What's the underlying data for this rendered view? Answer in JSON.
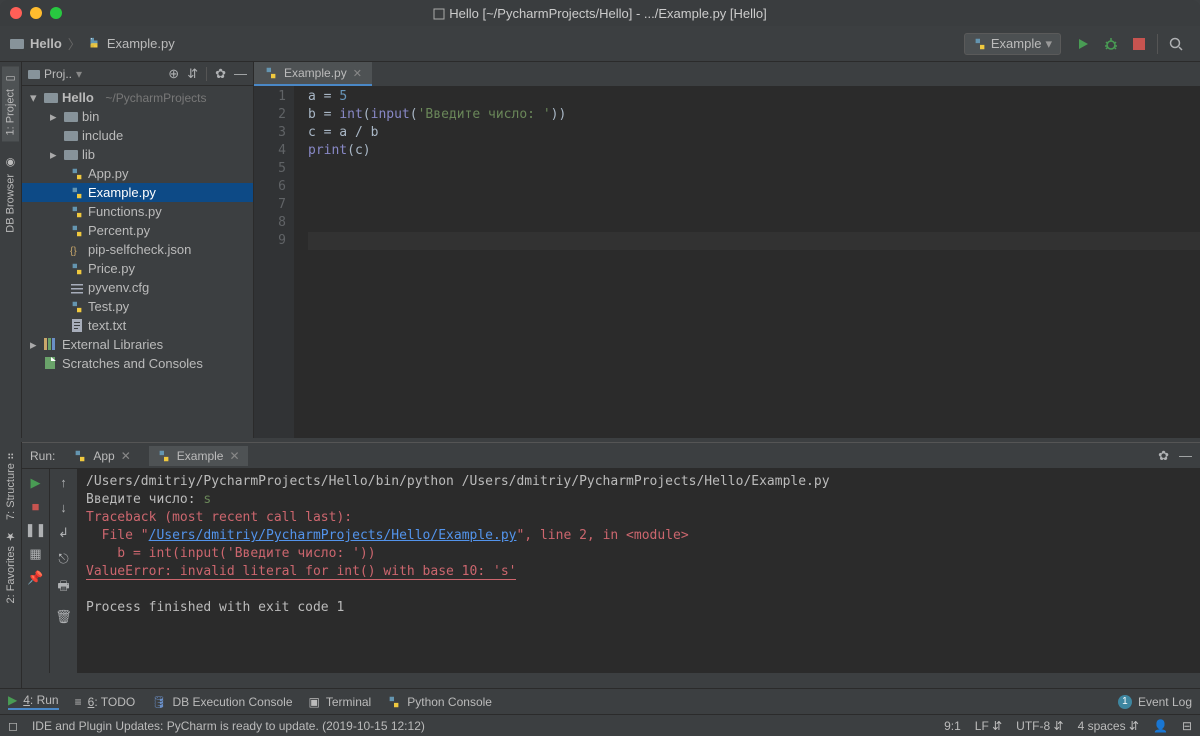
{
  "title": "Hello [~/PycharmProjects/Hello] - .../Example.py [Hello]",
  "breadcrumb": {
    "project": "Hello",
    "file": "Example.py"
  },
  "run_config": "Example",
  "project_pane": {
    "label": "Proj..",
    "root": {
      "name": "Hello",
      "path": "~/PycharmProjects"
    },
    "children": [
      {
        "name": "bin",
        "folder": true,
        "expand": true,
        "lvl": 1
      },
      {
        "name": "include",
        "folder": true,
        "expand": false,
        "lvl": 1
      },
      {
        "name": "lib",
        "folder": true,
        "expand": true,
        "lvl": 1
      },
      {
        "name": "App.py",
        "py": true,
        "lvl": 2
      },
      {
        "name": "Example.py",
        "py": true,
        "lvl": 2,
        "selected": true
      },
      {
        "name": "Functions.py",
        "py": true,
        "lvl": 2
      },
      {
        "name": "Percent.py",
        "py": true,
        "lvl": 2
      },
      {
        "name": "pip-selfcheck.json",
        "json": true,
        "lvl": 2
      },
      {
        "name": "Price.py",
        "py": true,
        "lvl": 2
      },
      {
        "name": "pyvenv.cfg",
        "cfg": true,
        "lvl": 2
      },
      {
        "name": "Test.py",
        "py": true,
        "lvl": 2
      },
      {
        "name": "text.txt",
        "txt": true,
        "lvl": 2
      }
    ],
    "ext_lib": "External Libraries",
    "scratches": "Scratches and Consoles"
  },
  "sidebar": {
    "project": "1: Project",
    "db": "DB Browser",
    "structure": "7: Structure",
    "favorites": "2: Favorites"
  },
  "editor": {
    "tab": "Example.py",
    "lines": [
      "a = 5",
      "b = int(input('Введите число: '))",
      "c = a / b",
      "print(c)"
    ],
    "line_count": 9
  },
  "run": {
    "label": "Run:",
    "tabs": [
      {
        "name": "App"
      },
      {
        "name": "Example",
        "active": true
      }
    ],
    "output": {
      "cmd": "/Users/dmitriy/PycharmProjects/Hello/bin/python /Users/dmitriy/PycharmProjects/Hello/Example.py",
      "prompt": "Введите число: ",
      "input": "s",
      "tb": "Traceback (most recent call last):",
      "file_pre": "  File \"",
      "file_link": "/Users/dmitriy/PycharmProjects/Hello/Example.py",
      "file_post": "\", line 2, in <module>",
      "src": "    b = int(input('Введите число: '))",
      "err": "ValueError: invalid literal for int() with base 10: 's'",
      "exit": "Process finished with exit code 1"
    }
  },
  "bottom": {
    "run": "4: Run",
    "todo": "6: TODO",
    "db": "DB Execution Console",
    "term": "Terminal",
    "pycon": "Python Console",
    "event": "Event Log",
    "event_badge": "1"
  },
  "status": {
    "msg": "IDE and Plugin Updates: PyCharm is ready to update. (2019-10-15 12:12)",
    "pos": "9:1",
    "lf": "LF",
    "enc": "UTF-8",
    "indent": "4 spaces"
  }
}
